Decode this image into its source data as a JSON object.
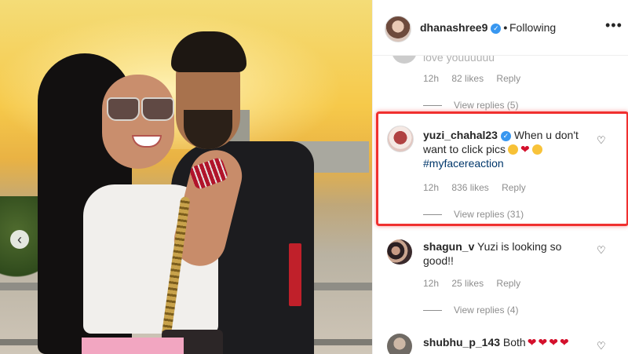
{
  "post": {
    "username": "dhanashree9",
    "separator": "•",
    "follow_status": "Following",
    "more_label": "•••"
  },
  "photo": {
    "prev_label": "‹"
  },
  "comments": [
    {
      "partial_text": "love youuuuuu",
      "time": "12h",
      "likes": "82 likes",
      "reply_label": "Reply",
      "view_replies": "View replies (5)"
    },
    {
      "username": "yuzi_chahal23",
      "text": "When u don't want to click pics",
      "hashtag": "#myfacereaction",
      "time": "12h",
      "likes": "836 likes",
      "reply_label": "Reply",
      "view_replies": "View replies (31)"
    },
    {
      "username": "shagun_v",
      "text": "Yuzi is looking so good!!",
      "time": "12h",
      "likes": "25 likes",
      "reply_label": "Reply",
      "view_replies": "View replies (4)"
    },
    {
      "username": "shubhu_p_143",
      "text": "Both"
    }
  ],
  "colors": {
    "highlight": "#f0302f",
    "link": "#00376b",
    "verified": "#3897f0"
  },
  "icons": [
    "chevron-left-icon",
    "verified-icon",
    "more-icon",
    "heart-icon"
  ]
}
